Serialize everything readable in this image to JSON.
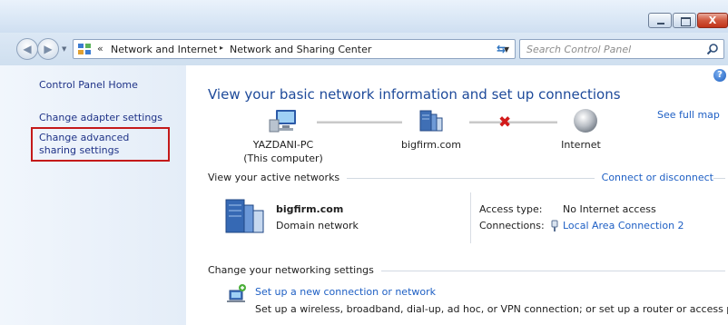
{
  "window": {
    "close_glyph": "X"
  },
  "address_bar": {
    "crumb_chevron": "«",
    "crumbs": [
      "Network and Internet",
      "Network and Sharing Center"
    ],
    "crumb_separator": "▸",
    "search_placeholder": "Search Control Panel"
  },
  "sidebar": {
    "home": "Control Panel Home",
    "links": [
      "Change adapter settings",
      "Change advanced sharing settings"
    ],
    "highlighted_link_index": 1,
    "highlight_color": "#c41a1a"
  },
  "main": {
    "title": "View your basic network information and set up connections",
    "see_full_map": "See full map",
    "help_glyph": "?",
    "map": {
      "nodes": [
        {
          "label": "YAZDANI-PC",
          "sub": "(This computer)",
          "icon": "computer-icon"
        },
        {
          "label": "bigfirm.com",
          "icon": "domain-server-icon"
        },
        {
          "label": "Internet",
          "icon": "globe-icon"
        }
      ],
      "broken_link_glyph": "✖"
    },
    "active_networks": {
      "heading": "View your active networks",
      "action": "Connect or disconnect",
      "network": {
        "name": "bigfirm.com",
        "type": "Domain network",
        "access_type_label": "Access type:",
        "access_type_value": "No Internet access",
        "connections_label": "Connections:",
        "connections_value": "Local Area Connection 2"
      }
    },
    "networking_settings": {
      "heading": "Change your networking settings",
      "items": [
        {
          "link": "Set up a new connection or network",
          "description": "Set up a wireless, broadband, dial-up, ad hoc, or VPN connection; or set up a router or access point."
        }
      ]
    }
  },
  "colors": {
    "link": "#1e5fc4",
    "title": "#1e4a9a",
    "sidebar_bg": "#e9f0f9",
    "error_red": "#d21a1a"
  }
}
